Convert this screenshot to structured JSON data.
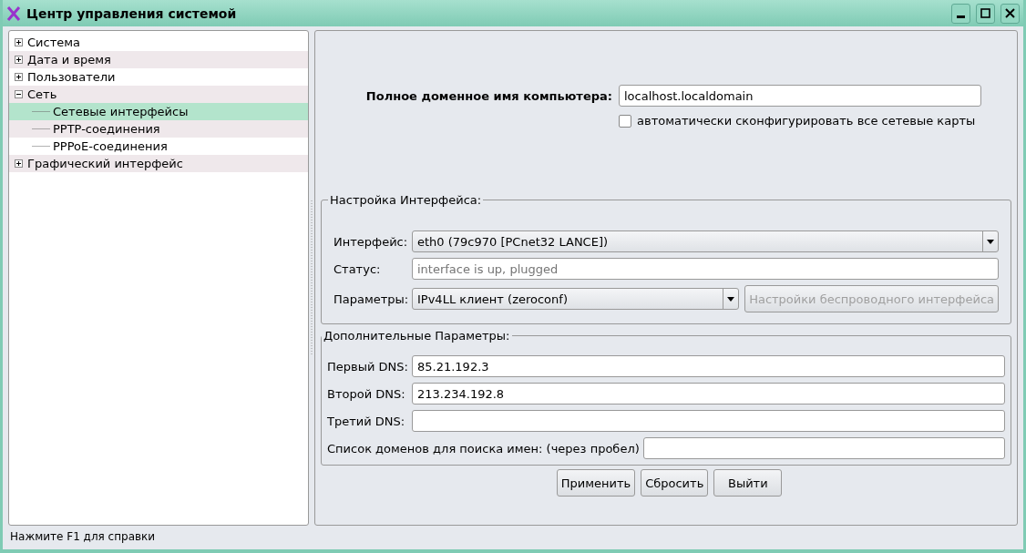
{
  "window": {
    "title": "Центр управления системой"
  },
  "tree": {
    "items": [
      {
        "label": "Система",
        "expanded": false,
        "selected": false
      },
      {
        "label": "Дата и время",
        "expanded": false,
        "selected": false
      },
      {
        "label": "Пользователи",
        "expanded": false,
        "selected": false
      },
      {
        "label": "Сеть",
        "expanded": true,
        "selected": false,
        "children": [
          {
            "label": "Сетевые интерфейсы",
            "selected": true
          },
          {
            "label": "PPTP-соединения",
            "selected": false
          },
          {
            "label": "PPPoE-соединения",
            "selected": false
          }
        ]
      },
      {
        "label": "Графический интерфейс",
        "expanded": false,
        "selected": false
      }
    ]
  },
  "hostname": {
    "label": "Полное доменное имя компьютера:",
    "value": "localhost.localdomain"
  },
  "auto_config": {
    "label": "автоматически сконфигурировать все сетевые карты",
    "checked": false
  },
  "interface_settings": {
    "title": "Настройка Интерфейса:",
    "rows": [
      {
        "kind": "dropdown",
        "label": "Интерфейс:",
        "value": "eth0 (79c970 [PCnet32 LANCE])"
      },
      {
        "kind": "text",
        "label": "Статус:",
        "placeholder": "interface is up, plugged"
      },
      {
        "kind": "dropdown",
        "label": "Параметры:",
        "value": "IPv4LL клиент (zeroconf)",
        "button": {
          "label": "Настройки беспроводного интерфейса",
          "disabled": true
        }
      }
    ]
  },
  "additional": {
    "title": "Дополнительные Параметры:",
    "rows": [
      {
        "label": "Первый DNS:",
        "value": "85.21.192.3"
      },
      {
        "label": "Второй DNS:",
        "value": "213.234.192.8"
      },
      {
        "label": "Третий DNS:",
        "value": ""
      },
      {
        "label": "Список доменов для поиска имен: (через пробел)",
        "value": ""
      }
    ]
  },
  "buttons": [
    "Применить",
    "Сбросить",
    "Выйти"
  ],
  "status_bar": "Нажмите F1 для справки"
}
